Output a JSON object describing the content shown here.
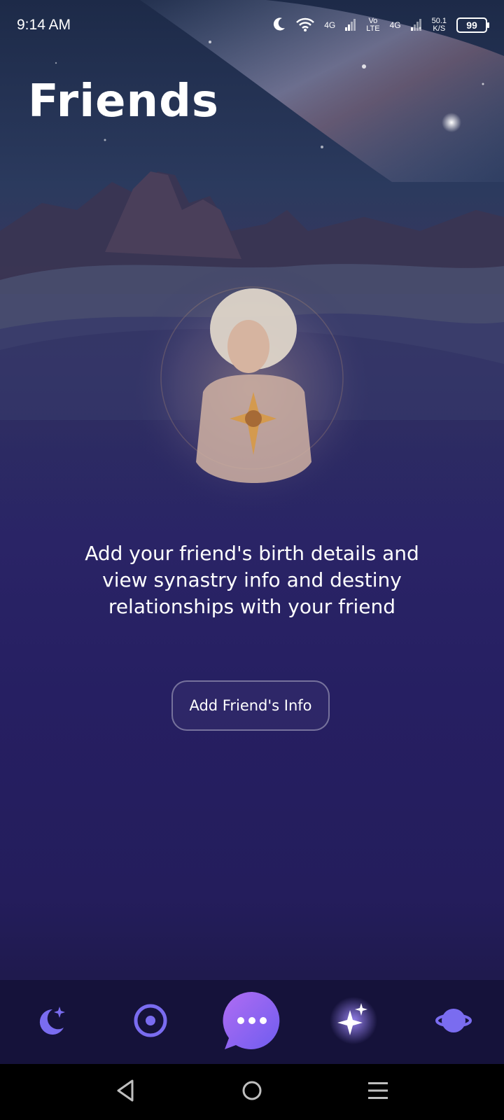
{
  "status_bar": {
    "time": "9:14 AM",
    "net1": "4G",
    "volte_top": "Vo",
    "volte_bottom": "LTE",
    "net2": "4G",
    "speed_value": "50.1",
    "speed_unit": "K/S",
    "battery": "99"
  },
  "header": {
    "title": "Friends"
  },
  "main": {
    "description": "Add your friend's birth details and view synastry info and destiny relationships with your friend",
    "add_button_label": "Add Friend's Info"
  },
  "bottom_nav": {
    "items": [
      {
        "icon": "moon-stars-icon"
      },
      {
        "icon": "target-icon"
      },
      {
        "icon": "chat-bubble-icon"
      },
      {
        "icon": "sparkles-icon",
        "active": true
      },
      {
        "icon": "planet-icon"
      }
    ],
    "accent": "#7a6cf0",
    "chat_gradient_start": "#b06cf2",
    "chat_gradient_end": "#6f5df0"
  },
  "system_nav": {
    "items": [
      {
        "icon": "back-triangle-icon"
      },
      {
        "icon": "home-circle-icon"
      },
      {
        "icon": "menu-lines-icon"
      }
    ]
  }
}
